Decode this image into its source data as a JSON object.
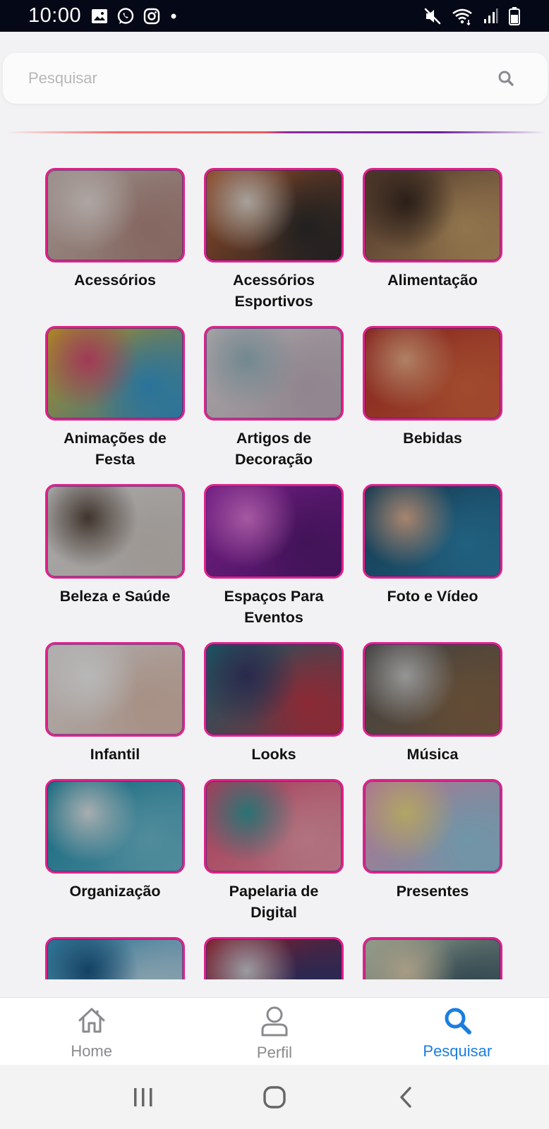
{
  "status_bar": {
    "time": "10:00",
    "left_icons": [
      "image-icon",
      "whatsapp-icon",
      "instagram-icon",
      "dot-icon"
    ],
    "right_icons": [
      "mute-icon",
      "wifi-icon",
      "signal-icon",
      "battery-icon"
    ]
  },
  "search": {
    "placeholder": "Pesquisar",
    "value": ""
  },
  "categories": [
    {
      "label": "Acessórios",
      "colors": [
        "#d8c7c0",
        "#b98f86",
        "#f1e6e2"
      ]
    },
    {
      "label": "Acessórios\nEsportivos",
      "colors": [
        "#c8683a",
        "#2d2d2d",
        "#e8e0d6"
      ]
    },
    {
      "label": "Alimentação",
      "colors": [
        "#6b4a3a",
        "#c9a26b",
        "#3b2b22"
      ]
    },
    {
      "label": "Animações de\nFesta",
      "colors": [
        "#f2c12e",
        "#3aa0d8",
        "#e0507a"
      ]
    },
    {
      "label": "Artigos de\nDecoração",
      "colors": [
        "#e9e4e6",
        "#c9b9c6",
        "#9fbdc8"
      ]
    },
    {
      "label": "Bebidas",
      "colors": [
        "#b8322a",
        "#e06840",
        "#f4b38a"
      ]
    },
    {
      "label": "Beleza e Saúde",
      "colors": [
        "#ececec",
        "#d9d2cc",
        "#5a4a40"
      ]
    },
    {
      "label": "Espaços Para\nEventos",
      "colors": [
        "#a02ab8",
        "#5b1b7a",
        "#e57be0"
      ]
    },
    {
      "label": "Foto e Vídeo",
      "colors": [
        "#1d4e6e",
        "#2e86b0",
        "#e8b89a"
      ]
    },
    {
      "label": "Infantil",
      "colors": [
        "#f4f1f2",
        "#e8c8b8",
        "#ffffff"
      ]
    },
    {
      "label": "Looks",
      "colors": [
        "#1f7a8a",
        "#c23a4a",
        "#3a3a6a"
      ]
    },
    {
      "label": "Música",
      "colors": [
        "#5a5a5a",
        "#8a6a4a",
        "#d0d0d0"
      ]
    },
    {
      "label": "Organização",
      "colors": [
        "#1c8fb0",
        "#6fc2d8",
        "#e8f2f4"
      ]
    },
    {
      "label": "Papelaria de\nDigital",
      "colors": [
        "#e8507a",
        "#f4a0b0",
        "#3aa0a0"
      ]
    },
    {
      "label": "Presentes",
      "colors": [
        "#f2a0c8",
        "#9ad0e8",
        "#f6e68a"
      ]
    },
    {
      "label": "",
      "colors": [
        "#3fa0d0",
        "#c8e4f2",
        "#1a5a8a"
      ]
    },
    {
      "label": "",
      "colors": [
        "#b02a3a",
        "#2a3a7a",
        "#d8d8e0"
      ]
    },
    {
      "label": "",
      "colors": [
        "#c8d8c0",
        "#3a5a6a",
        "#e8d8b8"
      ]
    }
  ],
  "bottom_nav": {
    "items": [
      {
        "label": "Home",
        "icon": "home-icon",
        "active": false
      },
      {
        "label": "Perfil",
        "icon": "user-icon",
        "active": false
      },
      {
        "label": "Pesquisar",
        "icon": "search-icon",
        "active": true
      }
    ]
  },
  "system_nav": [
    "recent-apps-icon",
    "home-circle-icon",
    "back-icon"
  ],
  "colors": {
    "accent": "#1a7ee0",
    "border": "#e0218a",
    "border_inner": "#6a1b9a"
  }
}
